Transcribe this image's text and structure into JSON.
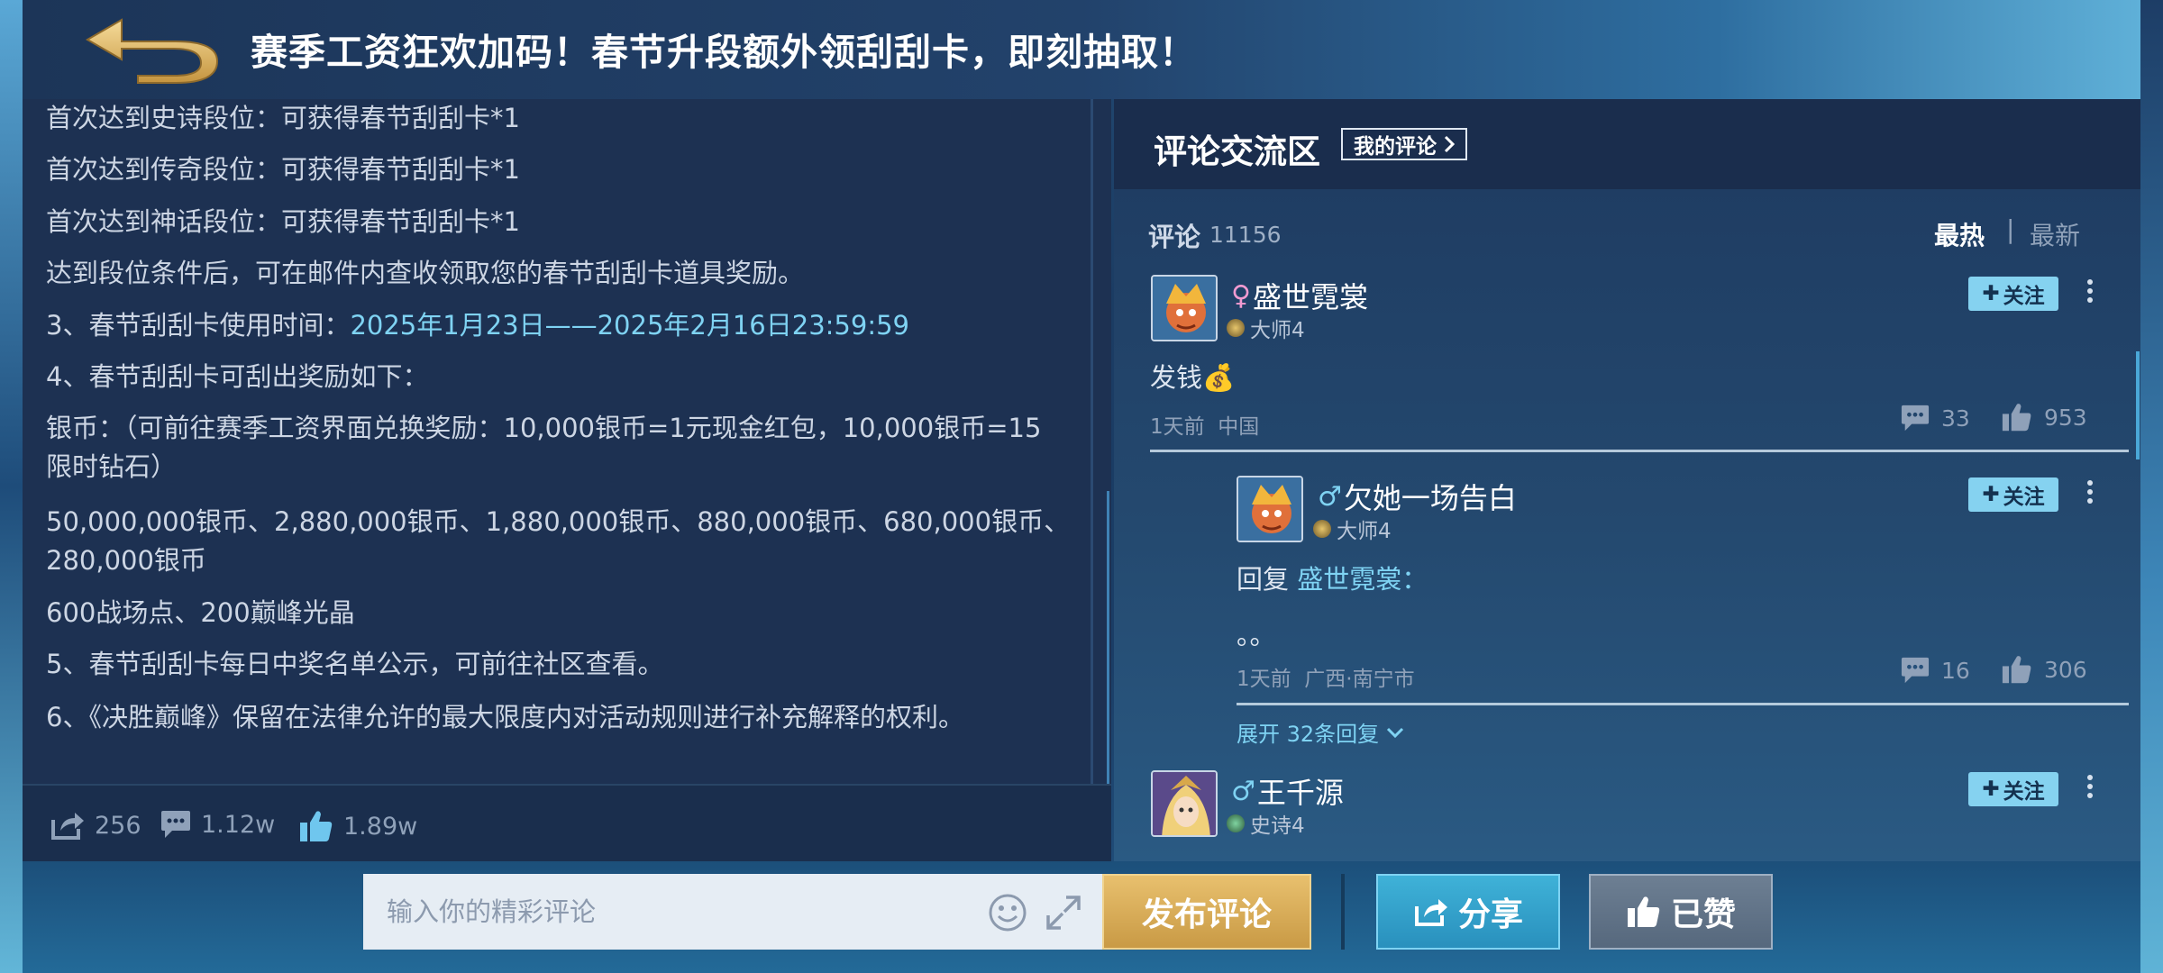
{
  "header": {
    "title": "赛季工资狂欢加码！春节升段额外领刮刮卡，即刻抽取！",
    "back_icon": "back-arrow-icon"
  },
  "article": {
    "lines": [
      {
        "text": "首次达到史诗段位：可获得春节刮刮卡*1"
      },
      {
        "text": "首次达到传奇段位：可获得春节刮刮卡*1"
      },
      {
        "text": "首次达到神话段位：可获得春节刮刮卡*1"
      },
      {
        "text": "达到段位条件后，可在邮件内查收领取您的春节刮刮卡道具奖励。"
      },
      {
        "prefix": "3、春节刮刮卡使用时间：",
        "highlight": "2025年1月23日——2025年2月16日23:59:59"
      },
      {
        "text": "4、春节刮刮卡可刮出奖励如下："
      },
      {
        "text": "银币：（可前往赛季工资界面兑换奖励：10,000银币=1元现金红包，10,000银币=15"
      },
      {
        "text": "限时钻石）"
      },
      {
        "text": "50,000,000银币、2,880,000银币、1,880,000银币、880,000银币、680,000银币、"
      },
      {
        "text": "280,000银币"
      },
      {
        "text": "600战场点、200巅峰光晶"
      },
      {
        "text": "5、春节刮刮卡每日中奖名单公示，可前往社区查看。"
      },
      {
        "text": "6、《决胜巅峰》保留在法律允许的最大限度内对活动规则进行补充解释的权利。"
      }
    ],
    "stats": {
      "shares": "256",
      "comments": "1.12w",
      "likes": "1.89w"
    }
  },
  "comments_panel": {
    "title": "评论交流区",
    "my_comments_label": "我的评论",
    "count_label": "评论",
    "count": "11156",
    "sort_hot": "最热",
    "sort_separator": "|",
    "sort_new": "最新",
    "follow_label": "关注",
    "comments": [
      {
        "gender_symbol": "♀",
        "gender_color": "#f29bd1",
        "username": "盛世霓裳",
        "rank": "大师4",
        "text": "发钱💰",
        "time": "1天前",
        "location": "中国",
        "replies": "33",
        "likes": "953"
      },
      {
        "gender_symbol": "♂",
        "gender_color": "#7fd3f3",
        "username": "欠她一场告白",
        "rank": "大师4",
        "reply_prefix": "回复",
        "reply_target": "盛世霓裳：",
        "text": "。。",
        "time": "1天前",
        "location": "广西·南宁市",
        "replies": "16",
        "likes": "306",
        "expand_label": "展开 32条回复"
      },
      {
        "gender_symbol": "♂",
        "gender_color": "#7fd3f3",
        "username": "王千源",
        "rank": "史诗4"
      }
    ]
  },
  "bottom_bar": {
    "input_placeholder": "输入你的精彩评论",
    "publish_label": "发布评论",
    "share_label": "分享",
    "liked_label": "已赞"
  },
  "colors": {
    "accent": "#7fd3f3",
    "gold": "#d9ad5a",
    "panel": "#1d3152"
  }
}
